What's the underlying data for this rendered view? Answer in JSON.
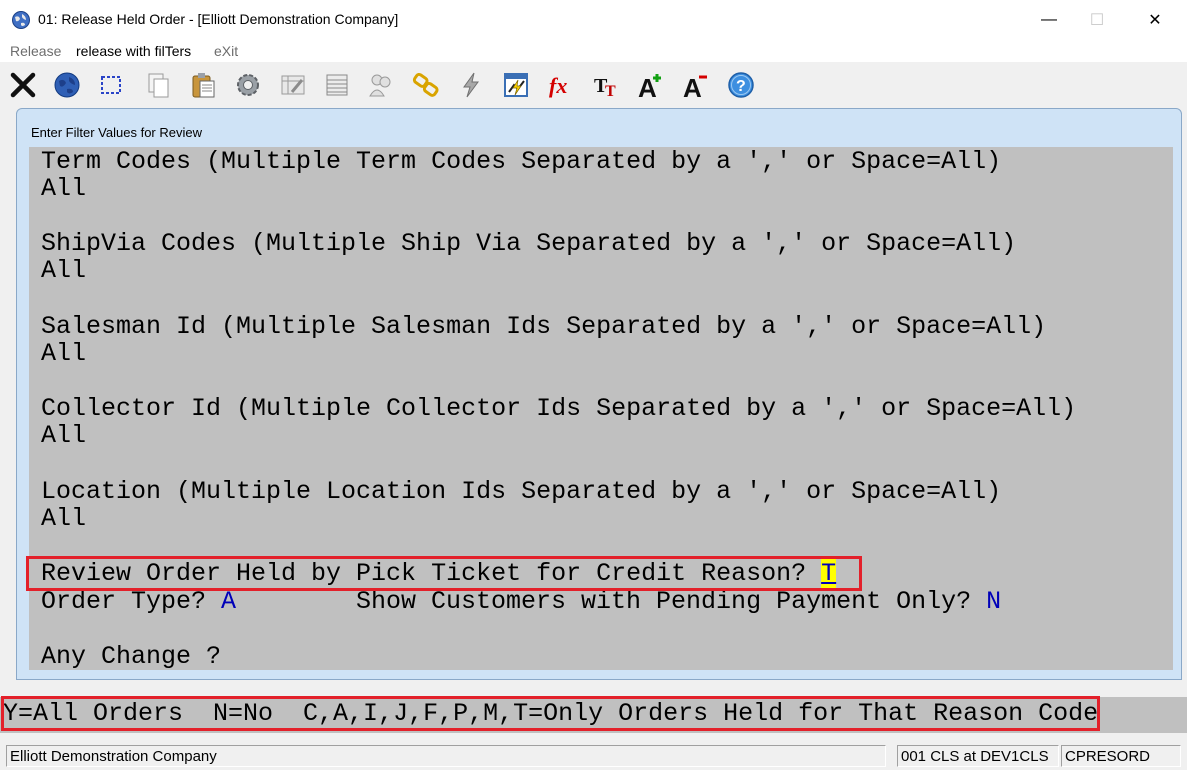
{
  "window": {
    "title": "01: Release Held Order - [Elliott Demonstration Company]",
    "min_glyph": "—",
    "max_glyph": "☐",
    "close_glyph": "✕"
  },
  "menu": {
    "items": [
      "Release",
      "release with filTers",
      "eXit"
    ]
  },
  "toolbar": {
    "icons": [
      "exit-icon",
      "globe-icon",
      "select-icon",
      "copy-icon",
      "paste-icon",
      "settings-icon",
      "edit-icon",
      "table-icon",
      "users-icon",
      "link-icon",
      "lightning-icon",
      "chart-icon",
      "function-icon",
      "font-icon",
      "font-increase-icon",
      "font-decrease-icon",
      "help-icon"
    ]
  },
  "dialog": {
    "title": "Enter Filter Values for Review",
    "lines": {
      "term_label": "Term Codes (Multiple Term Codes Separated by a ',' or Space=All)",
      "term_value": "All",
      "shipvia_label": "ShipVia Codes (Multiple Ship Via Separated by a ',' or Space=All)",
      "shipvia_value": "All",
      "salesman_label": "Salesman Id (Multiple Salesman Ids Separated by a ',' or Space=All)",
      "salesman_value": "All",
      "collector_label": "Collector Id (Multiple Collector Ids Separated by a ',' or Space=All)",
      "collector_value": "All",
      "location_label": "Location (Multiple Location Ids Separated by a ',' or Space=All)",
      "location_value": "All",
      "review_label": "Review Order Held by Pick Ticket for Credit Reason? ",
      "review_value": "T",
      "order_type_label": "Order Type? ",
      "order_type_value": "A",
      "pending_label": "Show Customers with Pending Payment Only? ",
      "pending_value": "N",
      "any_change": "Any Change ?"
    }
  },
  "prompt": {
    "text": "Y=All Orders  N=No  C,A,I,J,F,P,M,T=Only Orders Held for That Reason Code"
  },
  "status": {
    "company": "Elliott Demonstration Company",
    "session": "001 CLS at DEV1CLS",
    "program": "CPRESORD"
  },
  "colors": {
    "highlight_box": "#e3202a",
    "value_blue": "#0000b8",
    "cursor_bg": "#ffff00",
    "screen_bg": "#c0c0c0"
  }
}
